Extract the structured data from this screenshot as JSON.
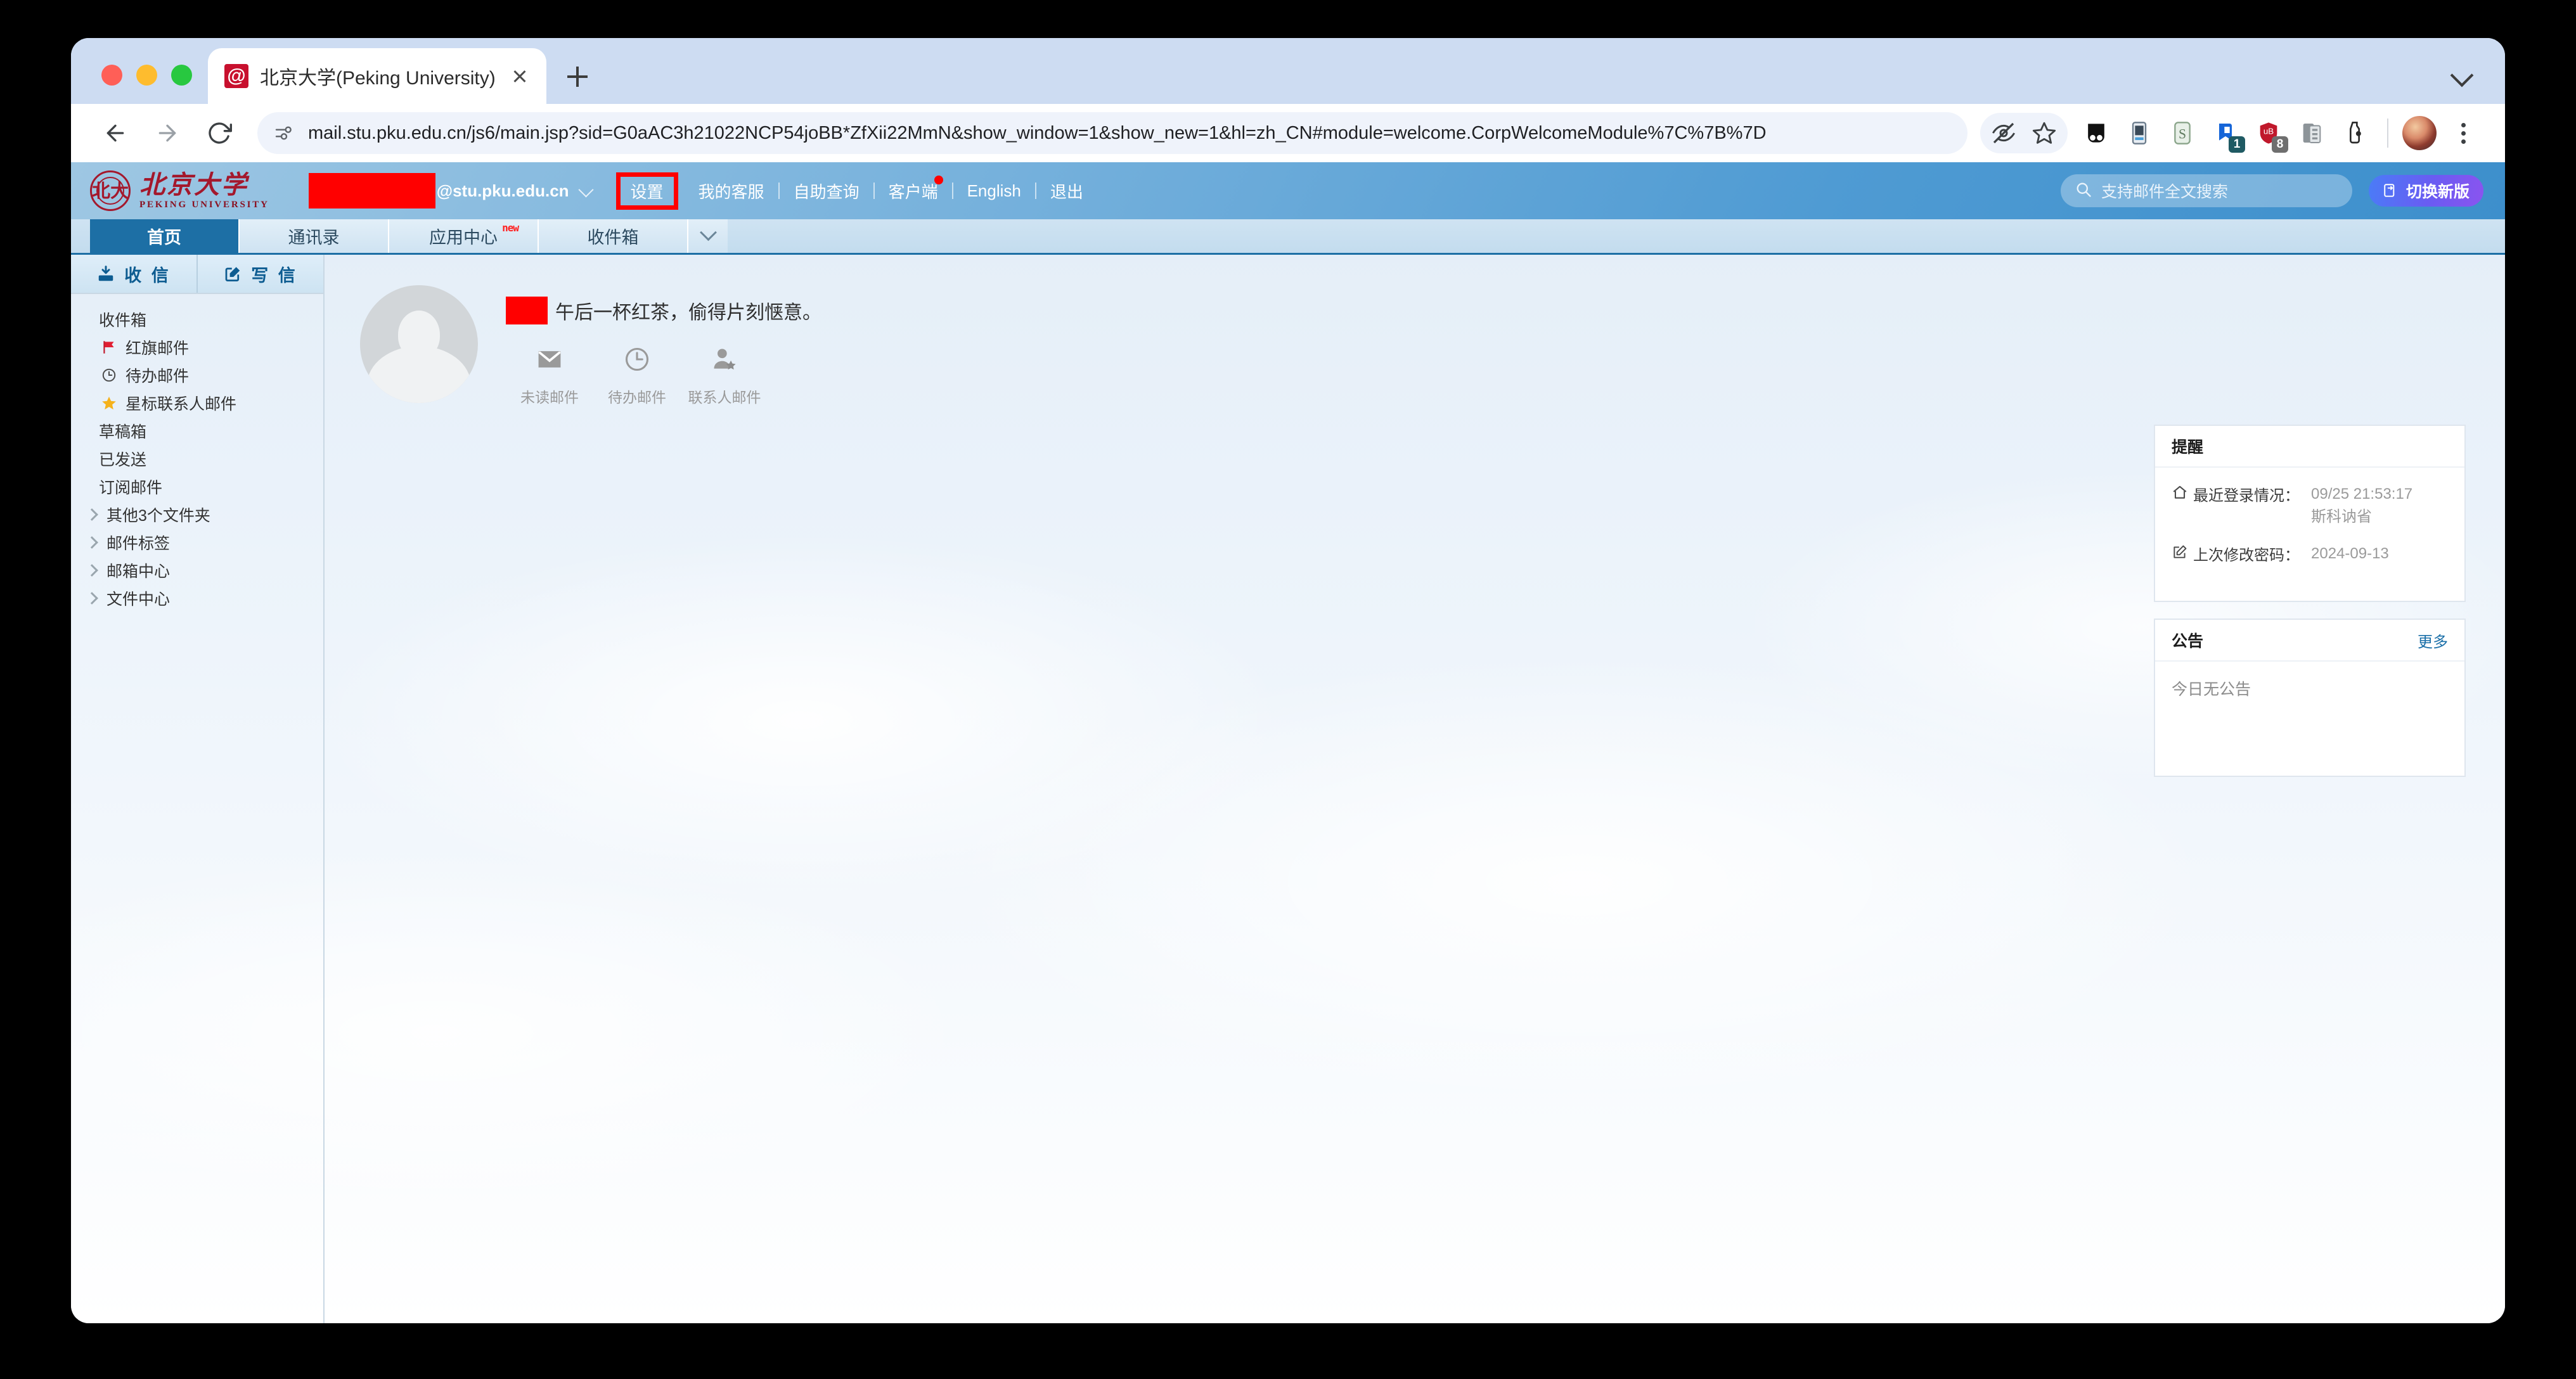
{
  "browser": {
    "tab": {
      "title": "北京大学(Peking University)",
      "favicon": "pku-mail-favicon"
    },
    "new_tab_label": "+",
    "omnibox": {
      "url": "mail.stu.pku.edu.cn/js6/main.jsp?sid=G0aAC3h21022NCP54joBB*ZfXii22MmN&show_window=1&show_new=1&hl=zh_CN#module=welcome.CorpWelcomeModule%7C%7B%7D",
      "site_info_icon": "site-settings-icon"
    },
    "toolbar_icons": [
      {
        "name": "tracking-protection-off-icon",
        "badge": ""
      },
      {
        "name": "bookmark-star-icon",
        "badge": ""
      },
      {
        "name": "extension-dark-icon",
        "badge": ""
      },
      {
        "name": "extension-bluebook-icon",
        "badge": ""
      },
      {
        "name": "extension-s-icon",
        "badge": ""
      },
      {
        "name": "extension-blue-tag-icon",
        "badge": "1"
      },
      {
        "name": "extension-red-shield-icon",
        "badge": "8"
      },
      {
        "name": "extension-copy-icon",
        "badge": ""
      },
      {
        "name": "extension-bottle-icon",
        "badge": ""
      }
    ],
    "profile": "profile-avatar",
    "menu": "kebab-menu-icon"
  },
  "header": {
    "logo_cn": "北京大学",
    "logo_en": "PEKING UNIVERSITY",
    "logo_seal_text": "北大",
    "username_redacted": true,
    "email_domain": "@stu.pku.edu.cn",
    "account_caret": "chevron-down-icon",
    "links": [
      {
        "label": "设置",
        "highlighted": true,
        "dot": false
      },
      {
        "label": "我的客服",
        "highlighted": false,
        "dot": false
      },
      {
        "label": "自助查询",
        "highlighted": false,
        "dot": false
      },
      {
        "label": "客户端",
        "highlighted": false,
        "dot": true
      },
      {
        "label": "English",
        "highlighted": false,
        "dot": false
      },
      {
        "label": "退出",
        "highlighted": false,
        "dot": false
      }
    ],
    "search": {
      "placeholder": "支持邮件全文搜索",
      "icon": "search-icon"
    },
    "switch_button": {
      "label": "切换新版",
      "icon": "switch-version-icon"
    },
    "highlight_color": "#ff0000"
  },
  "tabs": [
    {
      "label": "首页",
      "active": true,
      "badge": ""
    },
    {
      "label": "通讯录",
      "active": false,
      "badge": ""
    },
    {
      "label": "应用中心",
      "active": false,
      "badge": "new"
    },
    {
      "label": "收件箱",
      "active": false,
      "badge": ""
    }
  ],
  "tabs_overflow_icon": "chevron-down-icon",
  "sidebar": {
    "actions": [
      {
        "label": "收 信",
        "icon": "receive-mail-icon"
      },
      {
        "label": "写 信",
        "icon": "compose-mail-icon"
      }
    ],
    "folders": [
      {
        "label": "收件箱",
        "icon": "",
        "caret": false
      },
      {
        "label": "红旗邮件",
        "icon": "red-flag-icon",
        "caret": false
      },
      {
        "label": "待办邮件",
        "icon": "clock-icon",
        "caret": false
      },
      {
        "label": "星标联系人邮件",
        "icon": "star-icon",
        "caret": false
      },
      {
        "label": "草稿箱",
        "icon": "",
        "caret": false
      },
      {
        "label": "已发送",
        "icon": "",
        "caret": false
      },
      {
        "label": "订阅邮件",
        "icon": "",
        "caret": false
      },
      {
        "label": "其他3个文件夹",
        "icon": "",
        "caret": true
      },
      {
        "label": "邮件标签",
        "icon": "",
        "caret": true
      },
      {
        "label": "邮箱中心",
        "icon": "",
        "caret": true
      },
      {
        "label": "文件中心",
        "icon": "",
        "caret": true
      }
    ]
  },
  "welcome": {
    "avatar": "default-user-avatar",
    "name_redacted": true,
    "greeting": "午后一杯红茶，偷得片刻惬意。",
    "stats": [
      {
        "label": "未读邮件",
        "icon": "envelope-icon"
      },
      {
        "label": "待办邮件",
        "icon": "clock-icon"
      },
      {
        "label": "联系人邮件",
        "icon": "contact-star-icon"
      }
    ]
  },
  "reminder_card": {
    "title": "提醒",
    "rows": [
      {
        "icon": "home-icon",
        "label": "最近登录情况：",
        "values": [
          "09/25 21:53:17",
          "斯科讷省"
        ]
      },
      {
        "icon": "edit-icon",
        "label": "上次修改密码：",
        "values": [
          "2024-09-13"
        ]
      }
    ]
  },
  "notice_card": {
    "title": "公告",
    "more_label": "更多",
    "empty_text": "今日无公告"
  }
}
